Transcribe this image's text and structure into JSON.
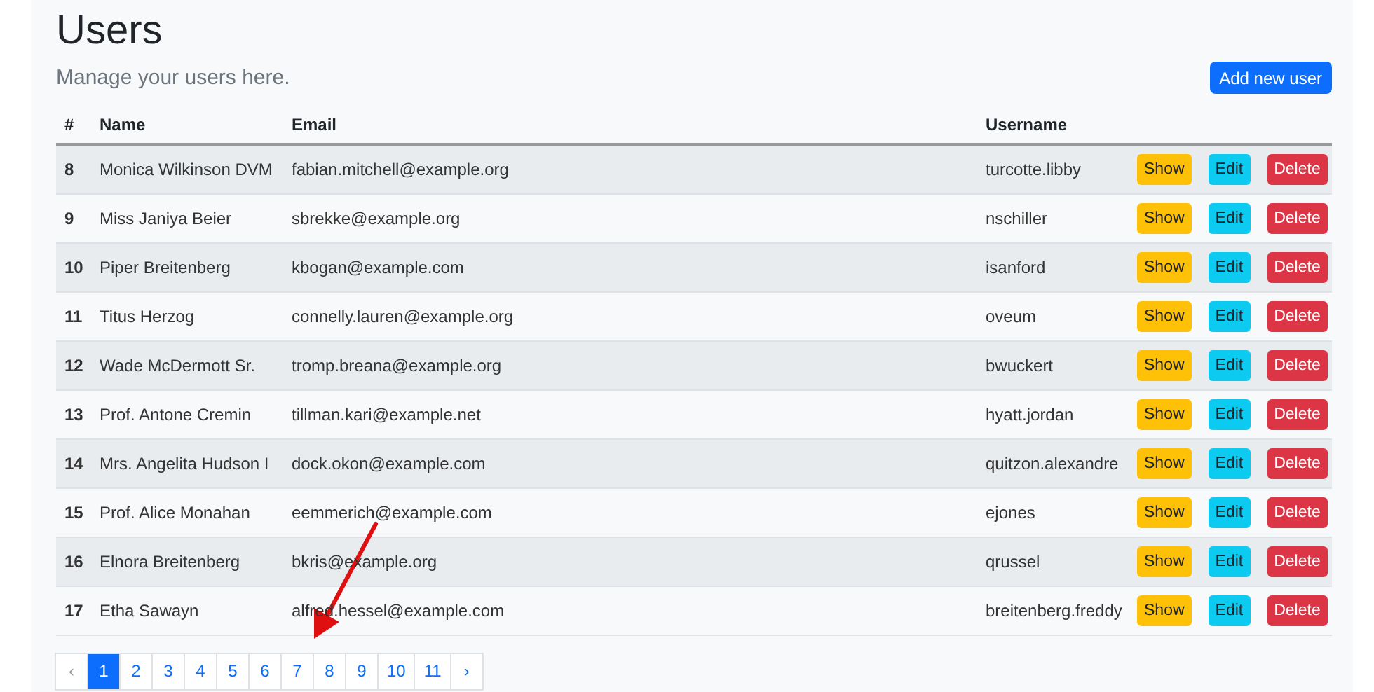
{
  "title": "Users",
  "subtitle": "Manage your users here.",
  "add_button": "Add new user",
  "table": {
    "columns": [
      "#",
      "Name",
      "Email",
      "Username"
    ],
    "rows": [
      {
        "id": "8",
        "name": "Monica Wilkinson DVM",
        "email": "fabian.mitchell@example.org",
        "username": "turcotte.libby",
        "actions": [
          "Show",
          "Edit",
          "Delete"
        ]
      },
      {
        "id": "9",
        "name": "Miss Janiya Beier",
        "email": "sbrekke@example.org",
        "username": "nschiller",
        "actions": [
          "Show",
          "Edit",
          "Delete"
        ]
      },
      {
        "id": "10",
        "name": "Piper Breitenberg",
        "email": "kbogan@example.com",
        "username": "isanford",
        "actions": [
          "Show",
          "Edit",
          "Delete"
        ]
      },
      {
        "id": "11",
        "name": "Titus Herzog",
        "email": "connelly.lauren@example.org",
        "username": "oveum",
        "actions": [
          "Show",
          "Edit",
          "Delete"
        ]
      },
      {
        "id": "12",
        "name": "Wade McDermott Sr.",
        "email": "tromp.breana@example.org",
        "username": "bwuckert",
        "actions": [
          "Show",
          "Edit",
          "Delete"
        ]
      },
      {
        "id": "13",
        "name": "Prof. Antone Cremin",
        "email": "tillman.kari@example.net",
        "username": "hyatt.jordan",
        "actions": [
          "Show",
          "Edit",
          "Delete"
        ]
      },
      {
        "id": "14",
        "name": "Mrs. Angelita Hudson I",
        "email": "dock.okon@example.com",
        "username": "quitzon.alexandre",
        "actions": [
          "Show",
          "Edit",
          "Delete"
        ]
      },
      {
        "id": "15",
        "name": "Prof. Alice Monahan",
        "email": "eemmerich@example.com",
        "username": "ejones",
        "actions": [
          "Show",
          "Edit",
          "Delete"
        ]
      },
      {
        "id": "16",
        "name": "Elnora Breitenberg",
        "email": "bkris@example.org",
        "username": "qrussel",
        "actions": [
          "Show",
          "Edit",
          "Delete"
        ]
      },
      {
        "id": "17",
        "name": "Etha Sawayn",
        "email": "alfred.hessel@example.com",
        "username": "breitenberg.freddy",
        "actions": [
          "Show",
          "Edit",
          "Delete"
        ]
      }
    ]
  },
  "pagination": {
    "prev": "‹",
    "next": "›",
    "pages": [
      {
        "label": "1",
        "selected": true
      },
      {
        "label": "2",
        "selected": false
      },
      {
        "label": "3",
        "selected": false
      },
      {
        "label": "4",
        "selected": false
      },
      {
        "label": "5",
        "selected": false
      },
      {
        "label": "6",
        "selected": false
      },
      {
        "label": "7",
        "selected": false
      },
      {
        "label": "8",
        "selected": false
      },
      {
        "label": "9",
        "selected": false
      },
      {
        "label": "10",
        "selected": false
      },
      {
        "label": "11",
        "selected": false
      }
    ]
  }
}
